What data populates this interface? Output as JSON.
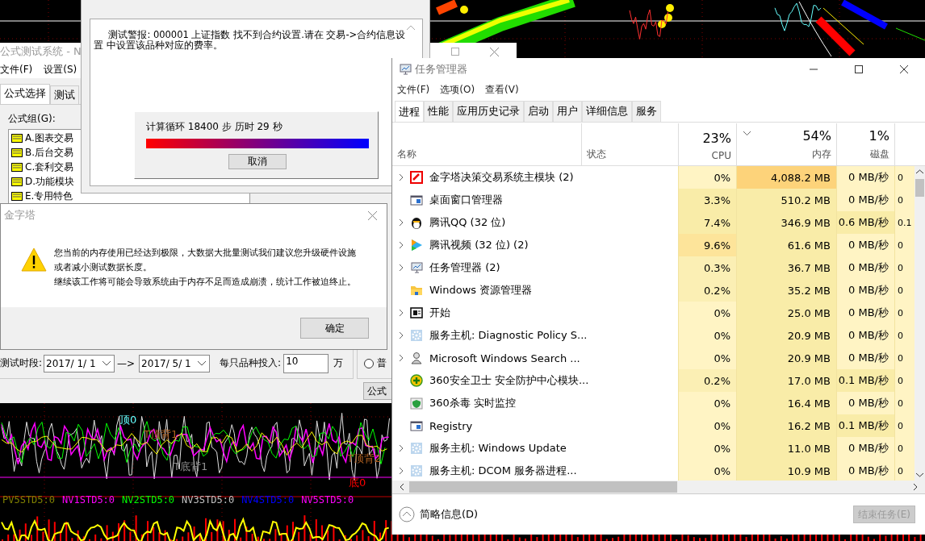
{
  "chart": {
    "labels": [
      {
        "text": "顶0",
        "color": "#66ffff"
      },
      {
        "text": "T顶背1",
        "color": "#b06020"
      },
      {
        "text": "T顶背2",
        "color": "#b06020"
      },
      {
        "text": "T底背1",
        "color": "#909090"
      },
      {
        "text": "底0",
        "color": "#ff0000"
      }
    ],
    "legend": [
      {
        "text": "PV5STD5:0",
        "color": "#808000"
      },
      {
        "text": "NV1STD5:0",
        "color": "#ff00ff"
      },
      {
        "text": "NV2STD5:0",
        "color": "#00ff00"
      },
      {
        "text": "NV3STD5:0",
        "color": "#c0c0c0"
      },
      {
        "text": "NV4STD5:0",
        "color": "#0000ff"
      },
      {
        "text": "NV5STD5:0",
        "color": "#ff00ff"
      }
    ]
  },
  "formula_window": {
    "title": "公式测试系统 - N",
    "menu": [
      "文件(F)",
      "设置(S)"
    ],
    "tabs": [
      {
        "label": "公式选择",
        "selected": true
      },
      {
        "label": "测试",
        "selected": false
      }
    ],
    "group_label": "公式组(G):",
    "groups": [
      "A.图表交易",
      "B.后台交易",
      "C.套利交易",
      "D.功能模块",
      "E.专用特色"
    ],
    "period_label": "测试时段:",
    "start_date": "2017/ 1/ 1",
    "arrow": "—>",
    "end_date": "2017/ 5/ 1",
    "invest_label": "每只品种投入:",
    "invest_value": "10",
    "invest_unit": "万",
    "radio": {
      "label": "普",
      "selected": false
    },
    "button": "公式"
  },
  "info_dialog": {
    "message": "测试警报: 000001 上证指数 找不到合约设置.请在 交易->合约信息设置 中设置该品种对应的费率。",
    "progress_text": "计算循环 18400 步 历时 29 秒",
    "level": 1,
    "cancel": "取消"
  },
  "alert_dialog": {
    "title": "金字塔",
    "lines": [
      "您当前的内存使用已经达到极限，大数据大批量测试我们建议您升级硬件设施",
      "或者减小测试数据长度。",
      "继续该工作将可能会导致系统由于内存不足而造成崩溃，统计工作被迫终止。"
    ],
    "ok": "确定"
  },
  "task_manager": {
    "title": "任务管理器",
    "menu": [
      "文件(F)",
      "选项(O)",
      "查看(V)"
    ],
    "tabs": [
      {
        "label": "进程",
        "selected": true
      },
      {
        "label": "性能",
        "selected": false
      },
      {
        "label": "应用历史记录",
        "selected": false
      },
      {
        "label": "启动",
        "selected": false
      },
      {
        "label": "用户",
        "selected": false
      },
      {
        "label": "详细信息",
        "selected": false
      },
      {
        "label": "服务",
        "selected": false
      }
    ],
    "columns": [
      {
        "label": "名称"
      },
      {
        "label": "状态"
      },
      {
        "label": "CPU",
        "total": "23%",
        "sorted": false
      },
      {
        "label": "内存",
        "total": "54%",
        "sorted": true
      },
      {
        "label": "磁盘",
        "total": "1%",
        "sorted": false
      }
    ],
    "rows": [
      {
        "name": "金字塔决策交易系统主模块 (2)",
        "expandable": true,
        "cpu": {
          "text": "0%",
          "color": "#fff4c4"
        },
        "memory": {
          "text": "4,088.2 MB",
          "color": "#fdd37a"
        },
        "disk": {
          "text": "0 MB/秒",
          "color": "#fff4c4"
        },
        "network": "0"
      },
      {
        "name": "桌面窗口管理器",
        "expandable": false,
        "cpu": {
          "text": "3.3%",
          "color": "#f9eca8"
        },
        "memory": {
          "text": "510.2 MB",
          "color": "#f9eca8"
        },
        "disk": {
          "text": "0 MB/秒",
          "color": "#fff4c4"
        },
        "network": "0"
      },
      {
        "name": "腾讯QQ (32 位)",
        "expandable": true,
        "cpu": {
          "text": "7.4%",
          "color": "#f9eca8"
        },
        "memory": {
          "text": "346.9 MB",
          "color": "#f9eca8"
        },
        "disk": {
          "text": "0.6 MB/秒",
          "color": "#f9eca8"
        },
        "network": "0.1"
      },
      {
        "name": "腾讯视频 (32 位) (2)",
        "expandable": true,
        "cpu": {
          "text": "9.6%",
          "color": "#fde49a"
        },
        "memory": {
          "text": "61.6 MB",
          "color": "#f9eca8"
        },
        "disk": {
          "text": "0 MB/秒",
          "color": "#fff4c4"
        },
        "network": "0"
      },
      {
        "name": "任务管理器 (2)",
        "expandable": true,
        "cpu": {
          "text": "0.3%",
          "color": "#fbefb4"
        },
        "memory": {
          "text": "36.7 MB",
          "color": "#f9eca8"
        },
        "disk": {
          "text": "0 MB/秒",
          "color": "#fff4c4"
        },
        "network": "0"
      },
      {
        "name": "Windows 资源管理器",
        "expandable": false,
        "cpu": {
          "text": "0.2%",
          "color": "#fbefb4"
        },
        "memory": {
          "text": "35.2 MB",
          "color": "#f9eca8"
        },
        "disk": {
          "text": "0 MB/秒",
          "color": "#fff4c4"
        },
        "network": "0"
      },
      {
        "name": "开始",
        "expandable": true,
        "cpu": {
          "text": "0%",
          "color": "#fff4c4"
        },
        "memory": {
          "text": "25.0 MB",
          "color": "#f9eca8"
        },
        "disk": {
          "text": "0 MB/秒",
          "color": "#fff4c4"
        },
        "network": "0"
      },
      {
        "name": "服务主机: Diagnostic Policy S...",
        "expandable": true,
        "cpu": {
          "text": "0%",
          "color": "#fff4c4"
        },
        "memory": {
          "text": "20.9 MB",
          "color": "#f9eca8"
        },
        "disk": {
          "text": "0 MB/秒",
          "color": "#fff4c4"
        },
        "network": "0"
      },
      {
        "name": "Microsoft Windows Search ...",
        "expandable": true,
        "cpu": {
          "text": "0%",
          "color": "#fff4c4"
        },
        "memory": {
          "text": "20.9 MB",
          "color": "#f9eca8"
        },
        "disk": {
          "text": "0 MB/秒",
          "color": "#fff4c4"
        },
        "network": "0"
      },
      {
        "name": "360安全卫士 安全防护中心模块...",
        "expandable": false,
        "cpu": {
          "text": "0.2%",
          "color": "#fbefb4"
        },
        "memory": {
          "text": "17.0 MB",
          "color": "#f9eca8"
        },
        "disk": {
          "text": "0.1 MB/秒",
          "color": "#f9eca8"
        },
        "network": "0"
      },
      {
        "name": "360杀毒 实时监控",
        "expandable": false,
        "cpu": {
          "text": "0%",
          "color": "#fff4c4"
        },
        "memory": {
          "text": "16.4 MB",
          "color": "#f9eca8"
        },
        "disk": {
          "text": "0 MB/秒",
          "color": "#fff4c4"
        },
        "network": "0"
      },
      {
        "name": "Registry",
        "expandable": false,
        "cpu": {
          "text": "0%",
          "color": "#fff4c4"
        },
        "memory": {
          "text": "16.2 MB",
          "color": "#f9eca8"
        },
        "disk": {
          "text": "0.1 MB/秒",
          "color": "#f9eca8"
        },
        "network": "0"
      },
      {
        "name": "服务主机: Windows Update",
        "expandable": true,
        "cpu": {
          "text": "0%",
          "color": "#fff4c4"
        },
        "memory": {
          "text": "11.0 MB",
          "color": "#f9eca8"
        },
        "disk": {
          "text": "0 MB/秒",
          "color": "#fff4c4"
        },
        "network": "0"
      },
      {
        "name": "服务主机: DCOM 服务器进程...",
        "expandable": true,
        "cpu": {
          "text": "0%",
          "color": "#fff4c4"
        },
        "memory": {
          "text": "10.9 MB",
          "color": "#f9eca8"
        },
        "disk": {
          "text": "0 MB/秒",
          "color": "#fff4c4"
        },
        "network": "0"
      }
    ],
    "footer": {
      "summary": "简略信息(D)",
      "end_task": {
        "label": "结束任务(E)",
        "disabled": true
      }
    }
  }
}
